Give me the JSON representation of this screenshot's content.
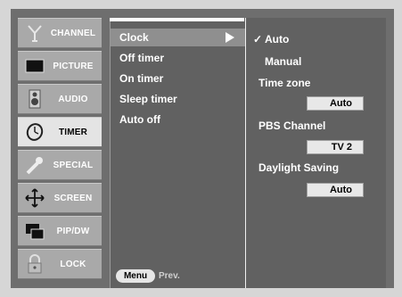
{
  "categories": [
    {
      "label": "CHANNEL",
      "icon": "channel-antenna-icon"
    },
    {
      "label": "PICTURE",
      "icon": "picture-screen-icon"
    },
    {
      "label": "AUDIO",
      "icon": "audio-speaker-icon"
    },
    {
      "label": "TIMER",
      "icon": "timer-clock-icon"
    },
    {
      "label": "SPECIAL",
      "icon": "special-wrench-icon"
    },
    {
      "label": "SCREEN",
      "icon": "screen-move-icon"
    },
    {
      "label": "PIP/DW",
      "icon": "pip-window-icon"
    },
    {
      "label": "LOCK",
      "icon": "lock-padlock-icon"
    }
  ],
  "active_category": "TIMER",
  "timer_menu": {
    "items": [
      "Clock",
      "Off timer",
      "On timer",
      "Sleep timer",
      "Auto off"
    ],
    "selected": "Clock"
  },
  "clock_panel": {
    "mode_options": [
      "Auto",
      "Manual"
    ],
    "selected_mode": "Auto",
    "check_mark": "✓",
    "time_zone_label": "Time zone",
    "time_zone_value": "Auto",
    "pbs_channel_label": "PBS Channel",
    "pbs_channel_value": "TV 2",
    "daylight_saving_label": "Daylight Saving",
    "daylight_saving_value": "Auto"
  },
  "footer": {
    "menu_button": "Menu",
    "prev_label": "Prev."
  }
}
